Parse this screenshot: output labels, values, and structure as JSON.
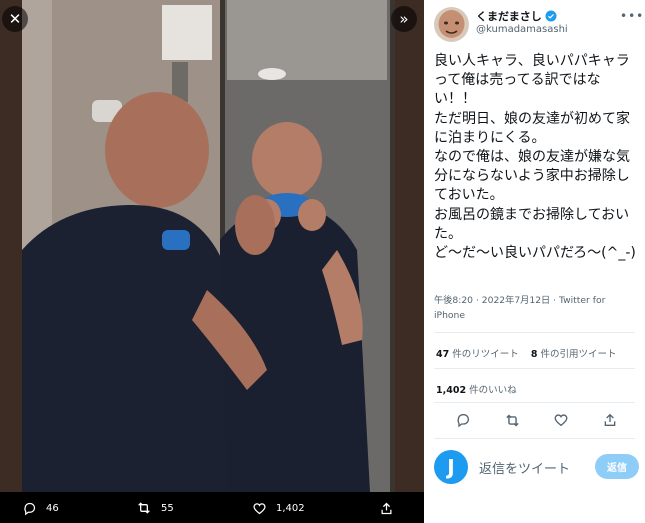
{
  "viewer": {
    "close_icon": "close-icon",
    "expand_icon": "chevron-double-right-icon",
    "actions": [
      {
        "icon": "reply-icon",
        "count": "46"
      },
      {
        "icon": "retweet-icon",
        "count": "55"
      },
      {
        "icon": "heart-icon",
        "count": "1,402"
      },
      {
        "icon": "share-icon",
        "count": ""
      }
    ]
  },
  "tweet": {
    "display_name": "くまだまさし",
    "handle": "@kumadamasashi",
    "text": "良い人キャラ、良いパパキャラって俺は売ってる訳ではない！！\nただ明日、娘の友達が初めて家に泊まりにくる。\nなので俺は、娘の友達が嫌な気分にならないよう家中お掃除しておいた。\nお風呂の鏡までお掃除しておいた。\nど〜だ〜い良いパパだろ〜(^_-)",
    "time": "午後8:20 · 2022年7月12日 · Twitter for iPhone",
    "retweets_count": "47",
    "retweets_label": "件のリツイート",
    "quotes_count": "8",
    "quotes_label": "件の引用ツイート",
    "likes_count": "1,402",
    "likes_label": "件のいいね"
  },
  "reply": {
    "avatar_letter": "J",
    "placeholder": "返信をツイート",
    "button": "返信"
  },
  "colors": {
    "accent": "#1d9bf0",
    "reply_button": "#8ecdf8",
    "muted_text": "#536471"
  }
}
